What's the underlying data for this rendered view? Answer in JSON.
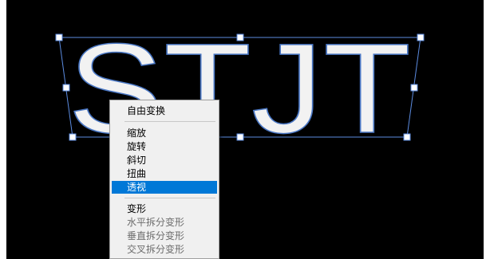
{
  "canvas": {
    "background": "#000000",
    "text": "STJT",
    "text_fill": "#f2f2f2",
    "text_outline": "#4a77c4",
    "bounding_box_color": "#5b8be0",
    "handle_fill": "#ffffff"
  },
  "context_menu": {
    "items": [
      {
        "label": "自由变换",
        "state": "normal"
      },
      {
        "label": "缩放",
        "state": "normal"
      },
      {
        "label": "旋转",
        "state": "normal"
      },
      {
        "label": "斜切",
        "state": "normal"
      },
      {
        "label": "扭曲",
        "state": "normal"
      },
      {
        "label": "透视",
        "state": "selected"
      },
      {
        "label": "变形",
        "state": "normal"
      },
      {
        "label": "水平拆分变形",
        "state": "disabled"
      },
      {
        "label": "垂直拆分变形",
        "state": "disabled"
      },
      {
        "label": "交叉拆分变形",
        "state": "disabled"
      }
    ],
    "selected_color": "#0078d7"
  }
}
